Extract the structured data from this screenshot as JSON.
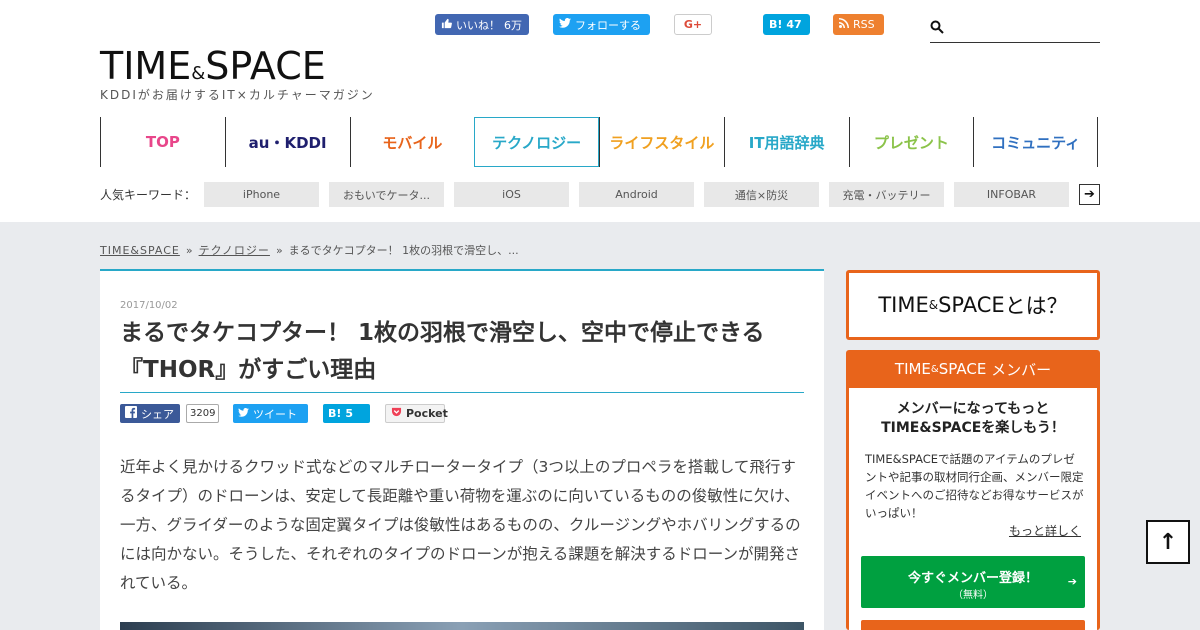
{
  "header": {
    "social": {
      "fb_like": "いいね！",
      "fb_count": "6万",
      "tw_follow": "フォローする",
      "gplus": "G+",
      "hatena": "B!",
      "hatena_count": "47",
      "rss": "RSS"
    },
    "search": {
      "placeholder": ""
    },
    "logo": {
      "part1": "TIME",
      "amp": "&",
      "part2": "SPACE"
    },
    "tagline": "KDDIがお届けするIT×カルチャーマガジン"
  },
  "nav": [
    {
      "label": "TOP",
      "color": "#e8468a"
    },
    {
      "label": "au・KDDI",
      "color": "#1f1f6e"
    },
    {
      "label": "モバイル",
      "color": "#e8641b"
    },
    {
      "label": "テクノロジー",
      "color": "#28a8c8"
    },
    {
      "label": "ライフスタイル",
      "color": "#f0a020"
    },
    {
      "label": "IT用語辞典",
      "color": "#28a8c8"
    },
    {
      "label": "プレゼント",
      "color": "#8bc34a"
    },
    {
      "label": "コミュニティ",
      "color": "#3070c0"
    }
  ],
  "keywords": {
    "label": "人気キーワード：",
    "items": [
      "iPhone",
      "おもいでケータ...",
      "iOS",
      "Android",
      "通信×防災",
      "充電・バッテリー",
      "INFOBAR"
    ],
    "arrow": "➔"
  },
  "breadcrumb": {
    "home": "TIME&SPACE",
    "category": "テクノロジー",
    "current": "まるでタケコプター！ 1枚の羽根で滑空し、...",
    "sep": "»"
  },
  "article": {
    "date": "2017/10/02",
    "title": "まるでタケコプター！ 1枚の羽根で滑空し、空中で停止できる『THOR』がすごい理由",
    "share": {
      "fb": "シェア",
      "fb_count": "3209",
      "tw": "ツイート",
      "hatena": "B!",
      "hatena_count": "5",
      "pocket": "Pocket"
    },
    "body": "近年よく見かけるクワッド式などのマルチロータータイプ（3つ以上のプロペラを搭載して飛行するタイプ）のドローンは、安定して長距離や重い荷物を運ぶのに向いているものの俊敏性に欠け、一方、グライダーのような固定翼タイプは俊敏性はあるものの、クルージングやホバリングするのには向かない。そうした、それぞれのタイプのドローンが抱える課題を解決するドローンが開発されている。"
  },
  "sidebar": {
    "about": {
      "part1": "TIME",
      "amp": "&",
      "part2": "SPACE",
      "suffix": "とは？"
    },
    "member": {
      "header_part1": "TIME",
      "header_amp": "&",
      "header_part2": "SPACE",
      "header_suffix": " メンバー",
      "title_line1": "メンバーになってもっと",
      "title_line2": "TIME&SPACEを楽しもう！",
      "desc": "TIME&SPACEで話題のアイテムのプレゼントや記事の取材同行企画、メンバー限定イベントへのご招待などお得なサービスがいっぱい！",
      "more": "もっと詳しく",
      "register_main": "今すぐメンバー登録！",
      "register_sub": "（無料）",
      "register_arrow": "➔"
    }
  },
  "to_top": "↑",
  "colors": {
    "accent_blue": "#28a8c8",
    "brand_orange": "#e8641b",
    "register_green": "#00a040"
  }
}
